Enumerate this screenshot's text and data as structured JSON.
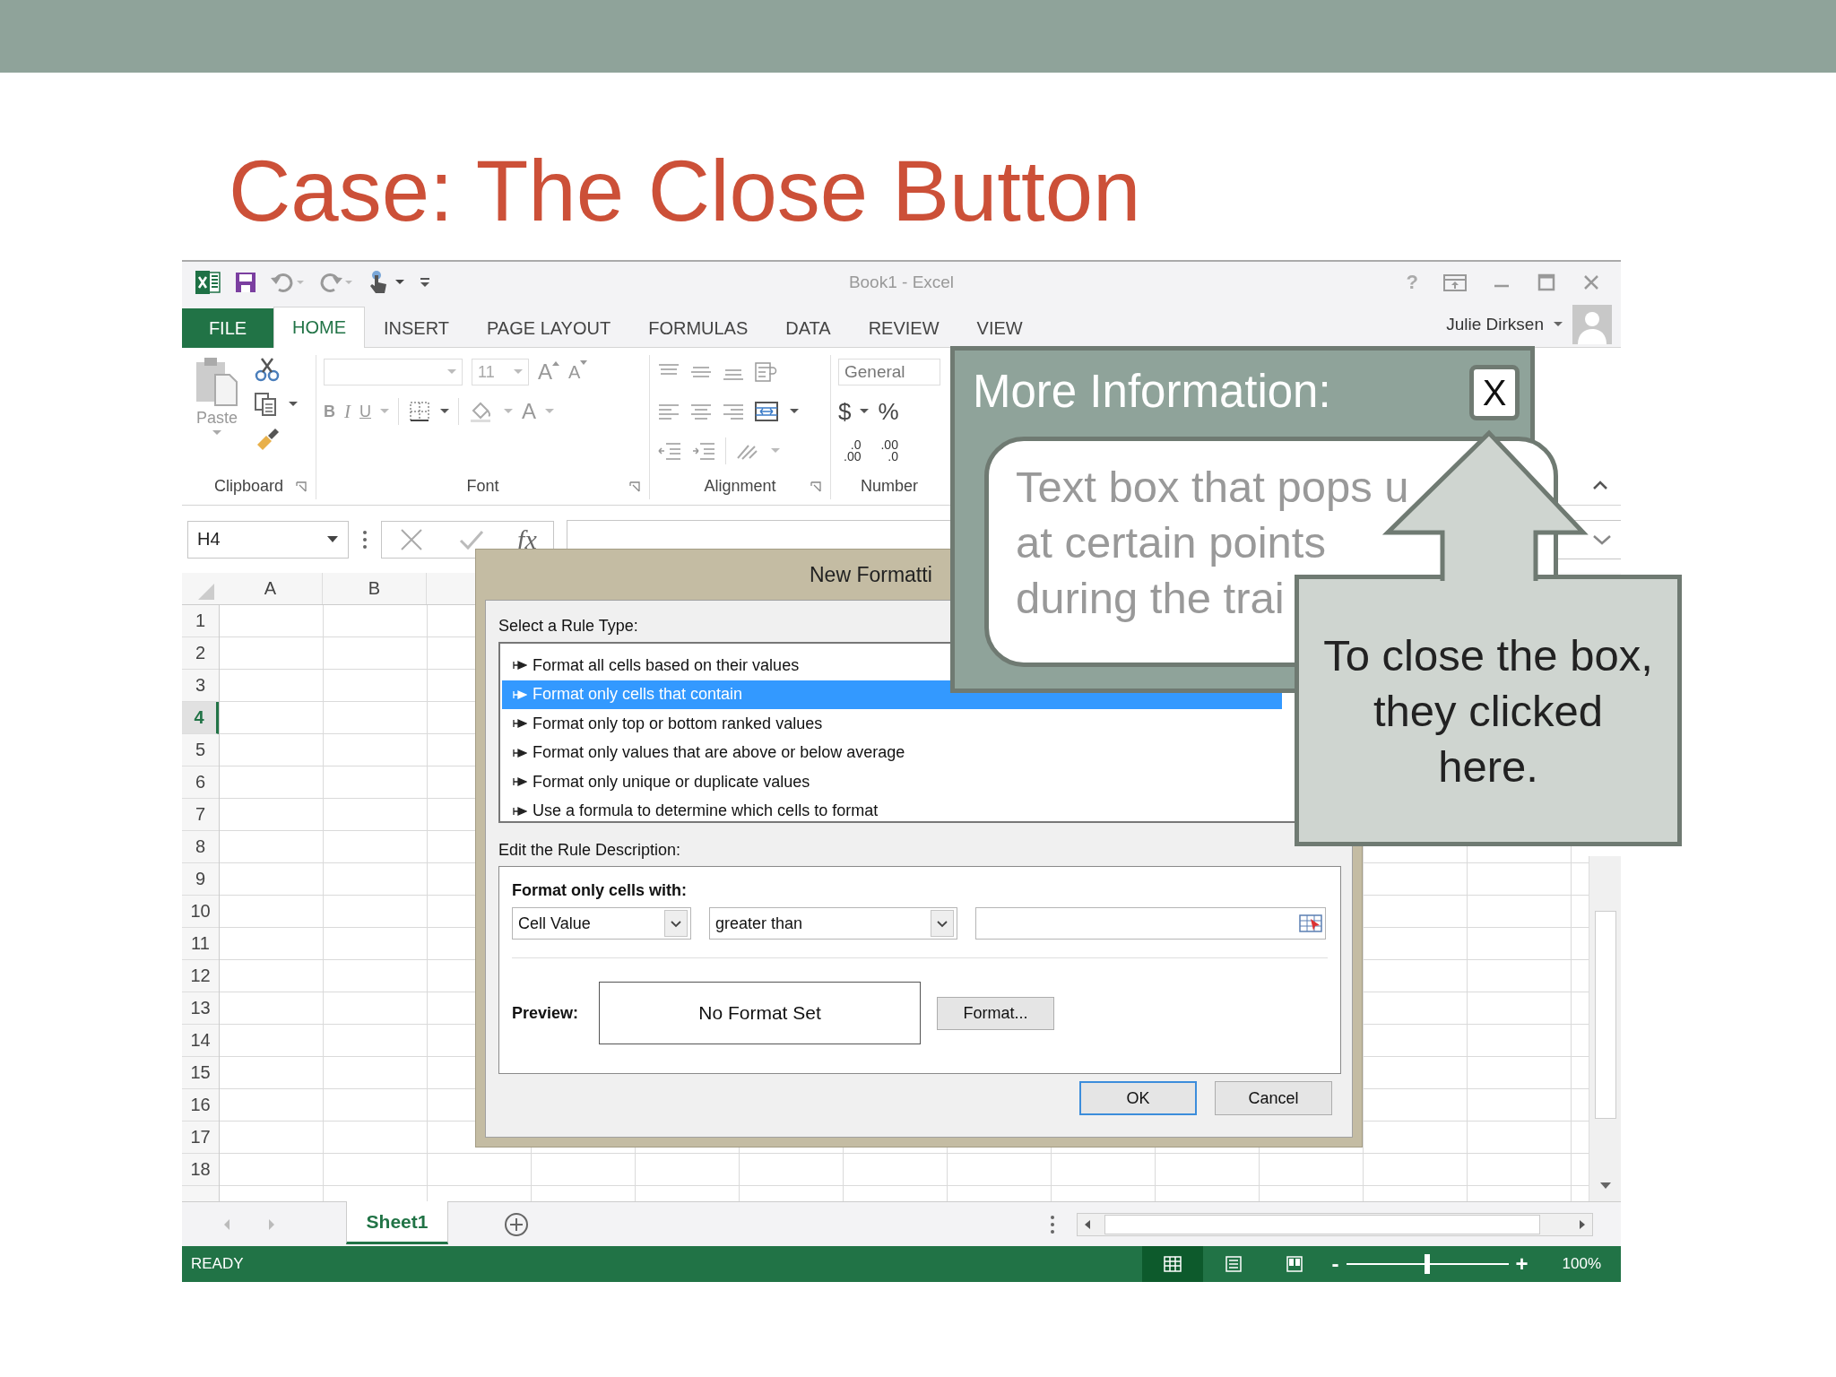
{
  "slide": {
    "title": "Case: The Close Button"
  },
  "window": {
    "title": "Book1 - Excel",
    "help": "?",
    "user": "Julie Dirksen"
  },
  "tabs": [
    {
      "label": "FILE",
      "kind": "file",
      "selected": false
    },
    {
      "label": "HOME",
      "kind": "tab",
      "selected": true
    },
    {
      "label": "INSERT",
      "kind": "tab",
      "selected": false
    },
    {
      "label": "PAGE LAYOUT",
      "kind": "tab",
      "selected": false
    },
    {
      "label": "FORMULAS",
      "kind": "tab",
      "selected": false
    },
    {
      "label": "DATA",
      "kind": "tab",
      "selected": false
    },
    {
      "label": "REVIEW",
      "kind": "tab",
      "selected": false
    },
    {
      "label": "VIEW",
      "kind": "tab",
      "selected": false
    }
  ],
  "ribbon": {
    "clipboard": {
      "paste": "Paste",
      "label": "Clipboard"
    },
    "font": {
      "size": "11",
      "grow": "A",
      "shrink": "A",
      "bold": "B",
      "italic": "I",
      "underline": "U",
      "font_color": "A",
      "label": "Font"
    },
    "alignment": {
      "label": "Alignment"
    },
    "number": {
      "format": "General",
      "currency": "$",
      "percent": "%",
      "decimals": [
        {
          "top": ".0",
          "bottom": ".00"
        },
        {
          "top": ".00",
          "bottom": ".0"
        }
      ],
      "label": "Number"
    }
  },
  "formula_bar": {
    "name_box": "H4",
    "function": "fx"
  },
  "grid": {
    "columns": [
      "A",
      "B"
    ],
    "rows": [
      {
        "label": "1",
        "selected": false
      },
      {
        "label": "2",
        "selected": false
      },
      {
        "label": "3",
        "selected": false
      },
      {
        "label": "4",
        "selected": true
      },
      {
        "label": "5",
        "selected": false
      },
      {
        "label": "6",
        "selected": false
      },
      {
        "label": "7",
        "selected": false
      },
      {
        "label": "8",
        "selected": false
      },
      {
        "label": "9",
        "selected": false
      },
      {
        "label": "10",
        "selected": false
      },
      {
        "label": "11",
        "selected": false
      },
      {
        "label": "12",
        "selected": false
      },
      {
        "label": "13",
        "selected": false
      },
      {
        "label": "14",
        "selected": false
      },
      {
        "label": "15",
        "selected": false
      },
      {
        "label": "16",
        "selected": false
      },
      {
        "label": "17",
        "selected": false
      },
      {
        "label": "18",
        "selected": false
      }
    ]
  },
  "dialog": {
    "title": "New Formatti",
    "rule_type_label": "Select a Rule Type:",
    "rule_types": [
      {
        "label": "Format all cells based on their values",
        "selected": false
      },
      {
        "label": "Format only cells that contain",
        "selected": true
      },
      {
        "label": "Format only top or bottom ranked values",
        "selected": false
      },
      {
        "label": "Format only values that are above or below average",
        "selected": false
      },
      {
        "label": "Format only unique or duplicate values",
        "selected": false
      },
      {
        "label": "Use a formula to determine which cells to format",
        "selected": false
      }
    ],
    "description_label": "Edit the Rule Description:",
    "condition_label": "Format only cells with:",
    "condition": {
      "subject": "Cell Value",
      "operator": "greater than"
    },
    "preview_label": "Preview:",
    "preview": "No Format Set",
    "format_button": "Format...",
    "buttons": [
      {
        "label": "OK",
        "default": true
      },
      {
        "label": "Cancel",
        "default": false
      }
    ]
  },
  "sheet_tabs": [
    {
      "label": "Sheet1",
      "selected": true
    }
  ],
  "status_bar": {
    "status": "READY",
    "views": [
      {
        "kind": "normal",
        "selected": true
      },
      {
        "kind": "page_layout",
        "selected": false
      },
      {
        "kind": "page_break",
        "selected": false
      }
    ],
    "zoom": {
      "minus": "-",
      "plus": "+",
      "level": 0.5,
      "reading": "100%"
    }
  },
  "popup": {
    "title": "More Information:",
    "close": "X",
    "lines": [
      "Text box that pops u",
      "at certain points",
      "during the trai"
    ]
  },
  "callout": {
    "lines": [
      "To close the box,",
      "they clicked",
      "here."
    ]
  }
}
